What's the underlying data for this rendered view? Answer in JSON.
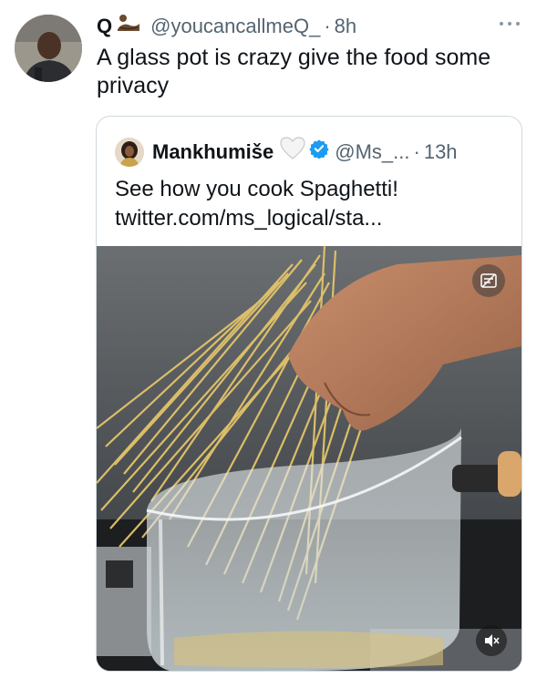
{
  "tweet": {
    "author_name": "Q",
    "author_emoji": "🏊",
    "handle": "@youcancallmeQ_",
    "separator": "·",
    "time": "8h",
    "text": "A glass pot is crazy give the food some privacy"
  },
  "quoted_tweet": {
    "author_name": "Mankhumiše",
    "heart_emoji": "🤍",
    "handle": "@Ms_...",
    "separator": "·",
    "time": "13h",
    "text_line1": "See how you cook Spaghetti!",
    "text_line2": "twitter.com/ms_logical/sta..."
  },
  "icons": {
    "more": "more-horizontal-icon",
    "verified": "verified-badge-icon",
    "alt_image": "image-description-icon",
    "mute": "volume-muted-icon"
  },
  "colors": {
    "verified_blue": "#1d9bf0",
    "secondary_text": "#536471",
    "border": "#cfd9de"
  }
}
